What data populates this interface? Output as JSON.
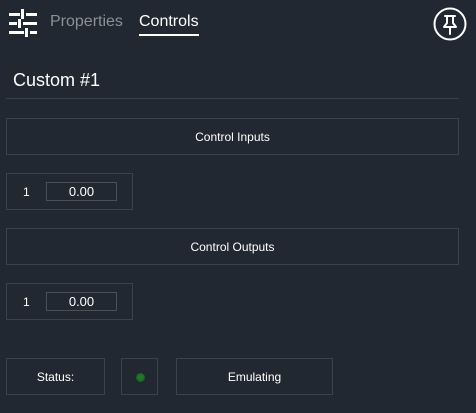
{
  "tabs": {
    "properties": "Properties",
    "controls": "Controls",
    "active": "Controls"
  },
  "icons": {
    "menu": "sliders-icon",
    "pin": "pin-icon"
  },
  "title": "Custom #1",
  "inputs": {
    "header": "Control Inputs",
    "rows": [
      {
        "index": "1",
        "value": "0.00"
      }
    ]
  },
  "outputs": {
    "header": "Control Outputs",
    "rows": [
      {
        "index": "1",
        "value": "0.00"
      }
    ]
  },
  "status": {
    "label": "Status:",
    "indicator_color": "#1f7a2a",
    "mode": "Emulating"
  },
  "colors": {
    "background": "#222831",
    "border": "#3c424b",
    "text": "#ffffff",
    "inactive_tab": "#8a9097"
  }
}
